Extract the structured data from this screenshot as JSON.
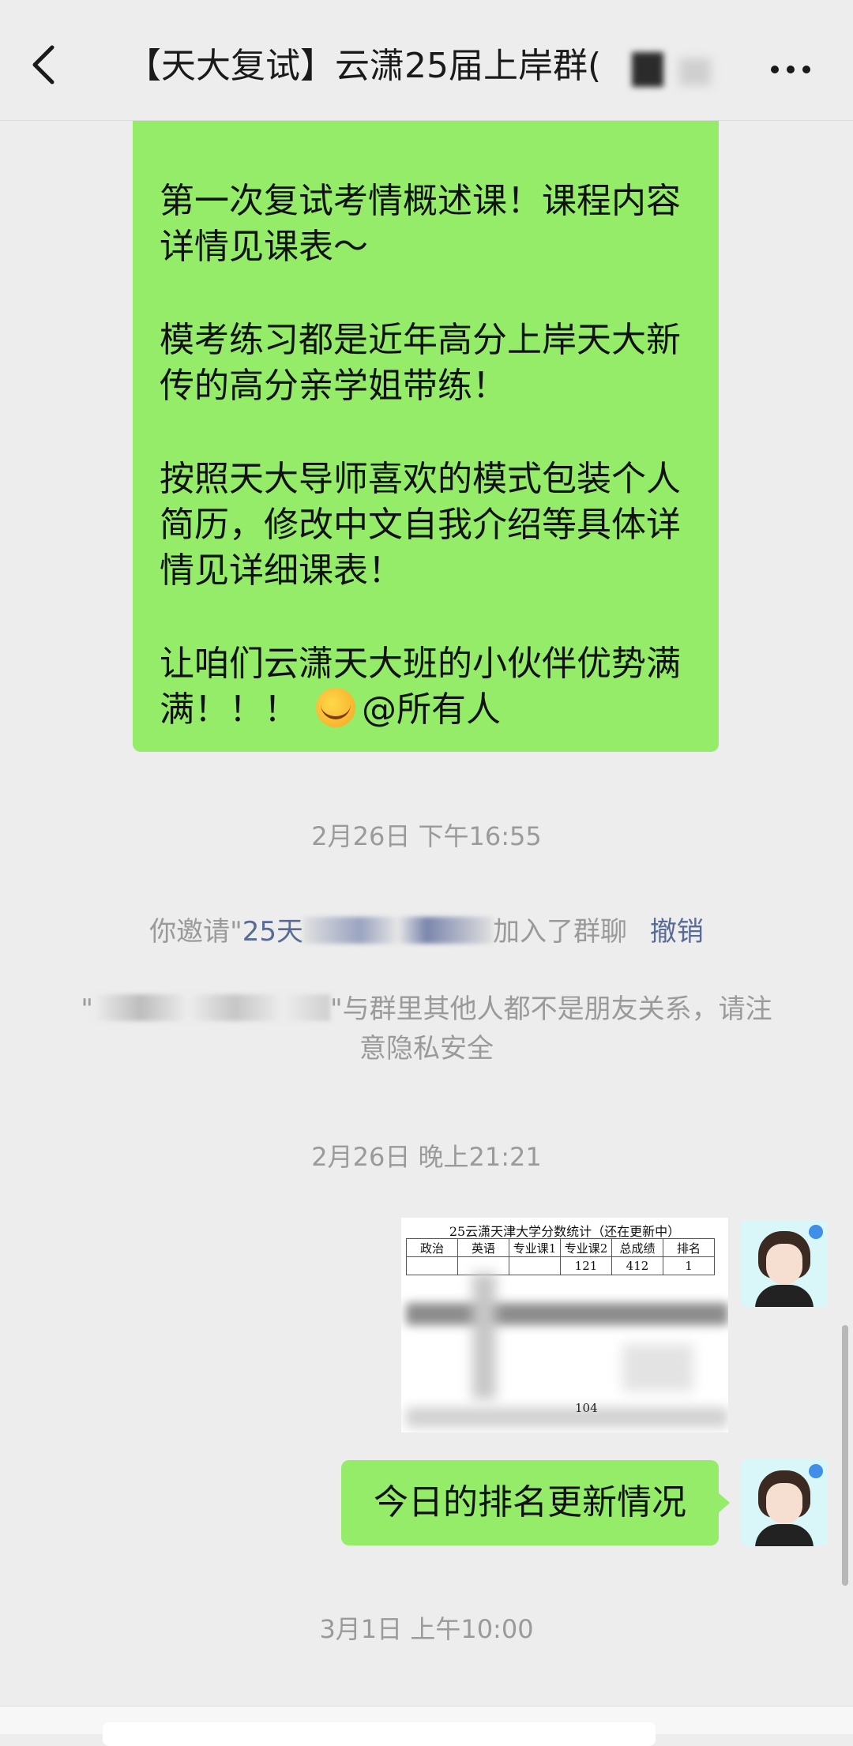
{
  "header": {
    "title": "【天大复试】云潇25届上岸群(",
    "back_icon": "chevron-left-icon",
    "more_icon": "more-dots-icon"
  },
  "messages": {
    "big_bubble": {
      "p1": "第一次复试考情概述课！课程内容详情见课表～",
      "p2": "模考练习都是近年高分上岸天大新传的高分亲学姐带练！",
      "p3": "按照天大导师喜欢的模式包装个人简历，修改中文自我介绍等具体详情见详细课表！",
      "p4_text": "让咱们云潇天大班的小伙伴优势满满！！！",
      "p4_mention": "@所有人",
      "emoji": "wink-emoji"
    },
    "time1": "2月26日 下午16:55",
    "system_invite": {
      "prefix": "你邀请\"",
      "name_visible": "25天",
      "suffix": "加入了群聊",
      "undo": "撤销"
    },
    "system_privacy": {
      "quote_open": "\"",
      "text": "\"与群里其他人都不是朋友关系，请注意隐私安全"
    },
    "time2": "2月26日 晚上21:21",
    "image_msg": {
      "title": "25云潇天津大学分数统计（还在更新中）",
      "headers": [
        "政治",
        "英语",
        "专业课1",
        "专业课2",
        "总成绩",
        "排名"
      ],
      "row1": [
        "",
        "",
        "",
        "121",
        "412",
        "1"
      ],
      "value_104": "104"
    },
    "text_msg": "今日的排名更新情况",
    "time3": "3月1日 上午10:00"
  },
  "colors": {
    "bubble_green": "#95ec69",
    "background": "#ededed",
    "link_blue": "#576b95",
    "system_gray": "#9a9a9a"
  }
}
